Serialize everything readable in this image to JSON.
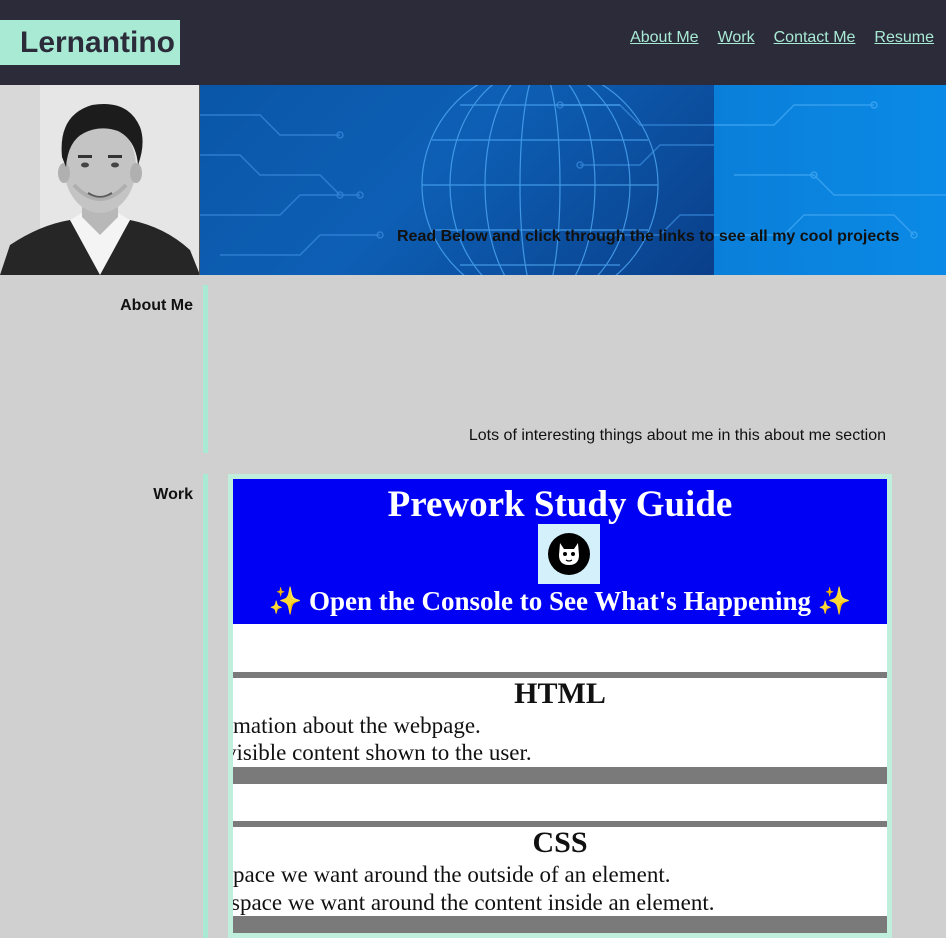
{
  "header": {
    "logo": "Lernantino",
    "nav": [
      "About Me",
      "Work",
      "Contact Me",
      "Resume"
    ]
  },
  "hero": {
    "tagline": "Read Below and click through the links to see all my cool projects"
  },
  "about": {
    "label": "About Me",
    "text": "Lots of interesting things about me in this about me section"
  },
  "work": {
    "label": "Work",
    "preview": {
      "title": "Prework Study Guide",
      "subtitle": "Open the Console to See What's Happening",
      "sparkle": "✨",
      "html_heading": "HTML",
      "html_lines": [
        "mation about the webpage.",
        "visible content shown to the user."
      ],
      "css_heading": "CSS",
      "css_lines": [
        "pace we want around the outside of an element.",
        "space we want around the content inside an element."
      ]
    }
  },
  "colors": {
    "header_bg": "#2b2b3a",
    "accent": "#a8ead4",
    "page_bg": "#d0d0d0",
    "guide_blue": "#0000f5"
  }
}
